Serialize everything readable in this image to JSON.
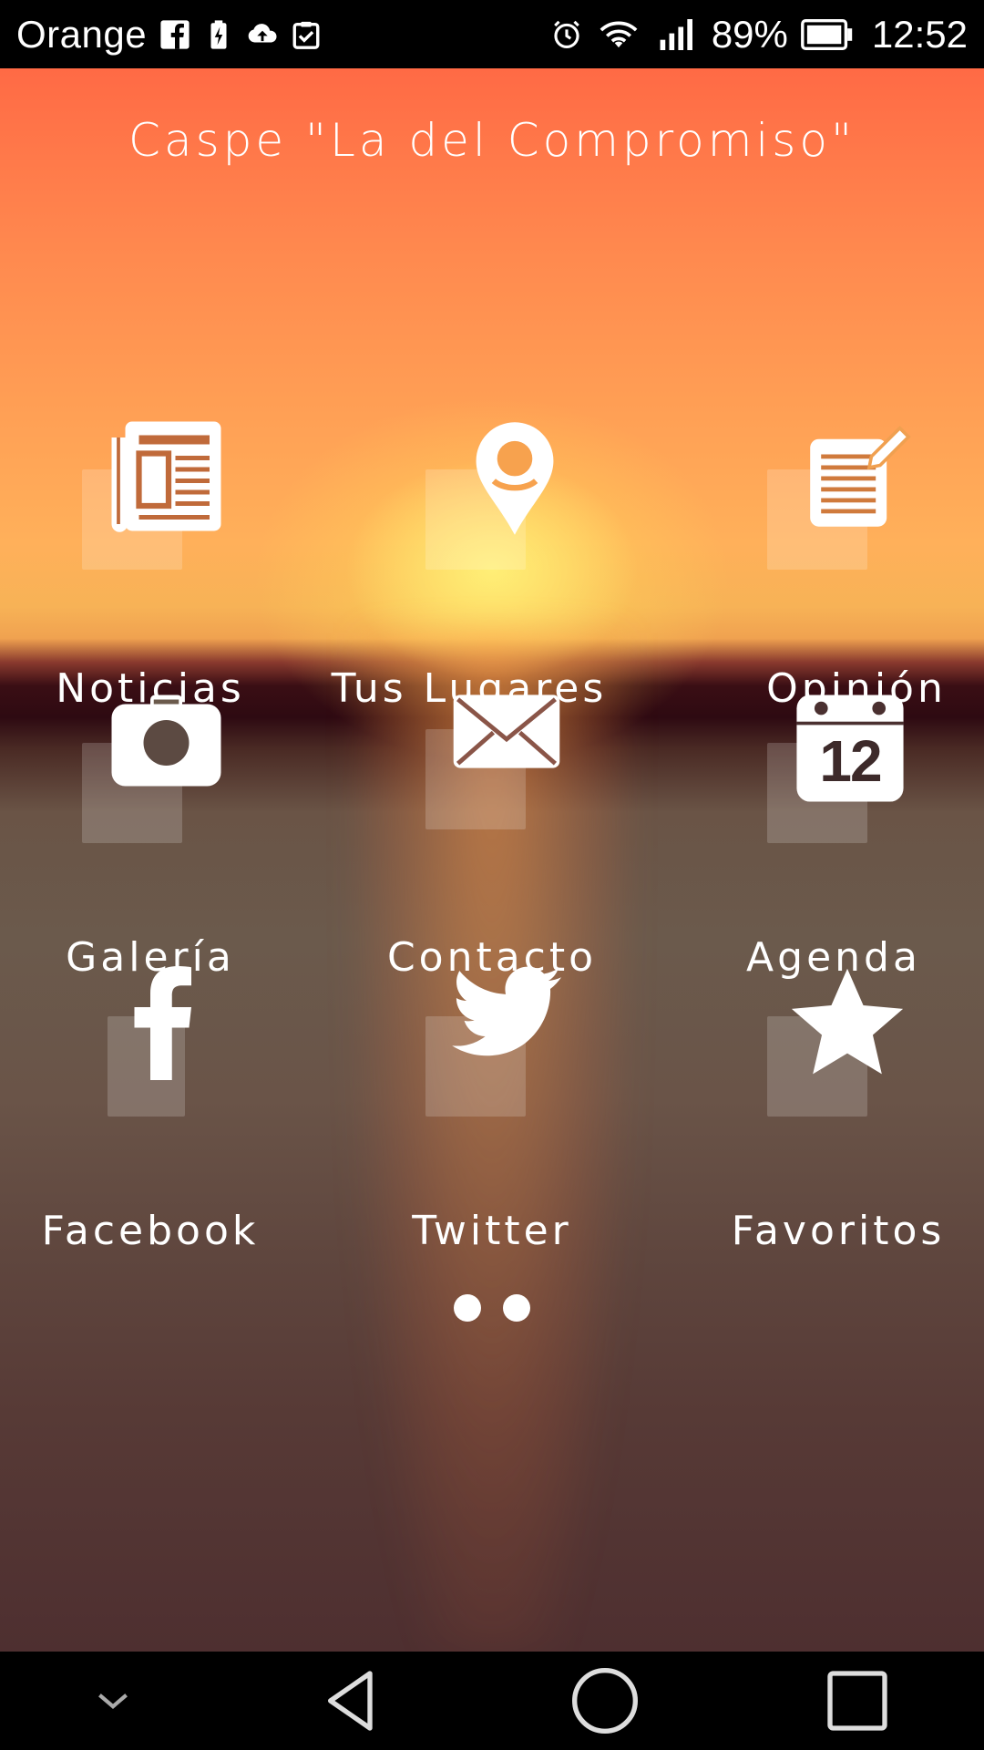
{
  "status_bar": {
    "carrier": "Orange",
    "battery_percent": "89%",
    "time": "12:52",
    "icons": [
      "facebook-icon",
      "battery-charging-icon",
      "cloud-upload-icon",
      "clipboard-check-icon",
      "alarm-icon",
      "wifi-icon",
      "signal-icon",
      "battery-icon"
    ]
  },
  "app": {
    "title": "Caspe \"La del Compromiso\""
  },
  "menu": {
    "noticias": "Noticias",
    "lugares": "Tus Lugares",
    "opinion": "Opinión",
    "galeria": "Galería",
    "contacto": "Contacto",
    "agenda": "Agenda",
    "agenda_day": "12",
    "facebook": "Facebook",
    "twitter": "Twitter",
    "favoritos": "Favoritos"
  },
  "pager": {
    "pages": 2,
    "current": 1
  },
  "nav_bar": {
    "buttons": [
      "chevron-down-icon",
      "back-icon",
      "home-icon",
      "recents-icon"
    ]
  },
  "colors": {
    "accent_text": "#ffffff",
    "statusbar_bg": "#000000",
    "sky_top": "#ff6a45",
    "sun": "#ffe07a"
  }
}
